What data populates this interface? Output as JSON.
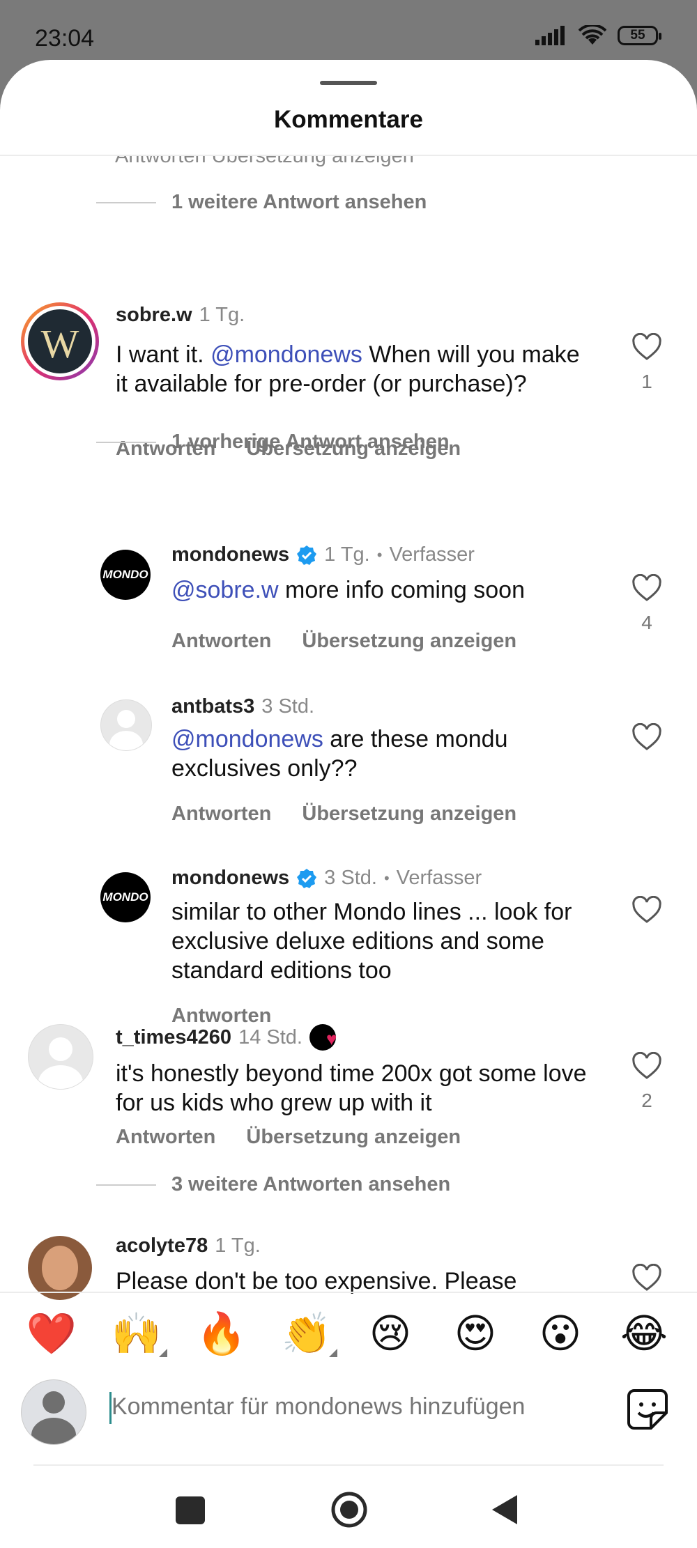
{
  "status": {
    "time": "23:04",
    "battery": "55"
  },
  "sheet": {
    "title": "Kommentare",
    "ghost_row": "Antworten    Übersetzung anzeigen"
  },
  "labels": {
    "reply": "Antworten",
    "translate": "Übersetzung anzeigen",
    "author": "Verfasser"
  },
  "threads": {
    "view_more_1": "1 weitere Antwort ansehen",
    "view_prev_1": "1 vorherige Antwort ansehen",
    "view_more_3": "3 weitere Antworten ansehen"
  },
  "comments": [
    {
      "user": "sobre.w",
      "time": "1 Tg.",
      "text_pre": "I want it. ",
      "mention": "@mondonews",
      "text_post": " When will you make it available for pre-order (or purchase)?",
      "likes": "1"
    },
    {
      "user": "mondonews",
      "time": "1 Tg.",
      "mention": "@sobre.w",
      "text_post": " more info coming soon",
      "likes": "4"
    },
    {
      "user": "antbats3",
      "time": "3 Std.",
      "mention": "@mondonews",
      "text_post": " are these mondu exclusives only??"
    },
    {
      "user": "mondonews",
      "time": "3 Std.",
      "text": "similar to other Mondo lines ... look for exclusive deluxe editions and some standard editions too"
    },
    {
      "user": "t_times4260",
      "time": "14 Std.",
      "text": "it's honestly beyond time 200x got some love for us kids who grew up with it",
      "likes": "2"
    },
    {
      "user": "acolyte78",
      "time": "1 Tg.",
      "text": "Please don't be too expensive. Please"
    }
  ],
  "emoji_bar": [
    "❤️",
    "🙌",
    "🔥",
    "👏",
    "😢",
    "😍",
    "😮",
    "😂"
  ],
  "composer": {
    "placeholder": "Kommentar für mondonews hinzufügen"
  },
  "colors": {
    "mention": "#3d4fb8",
    "verified": "#1d9bf0",
    "secondary_text": "#777777"
  }
}
